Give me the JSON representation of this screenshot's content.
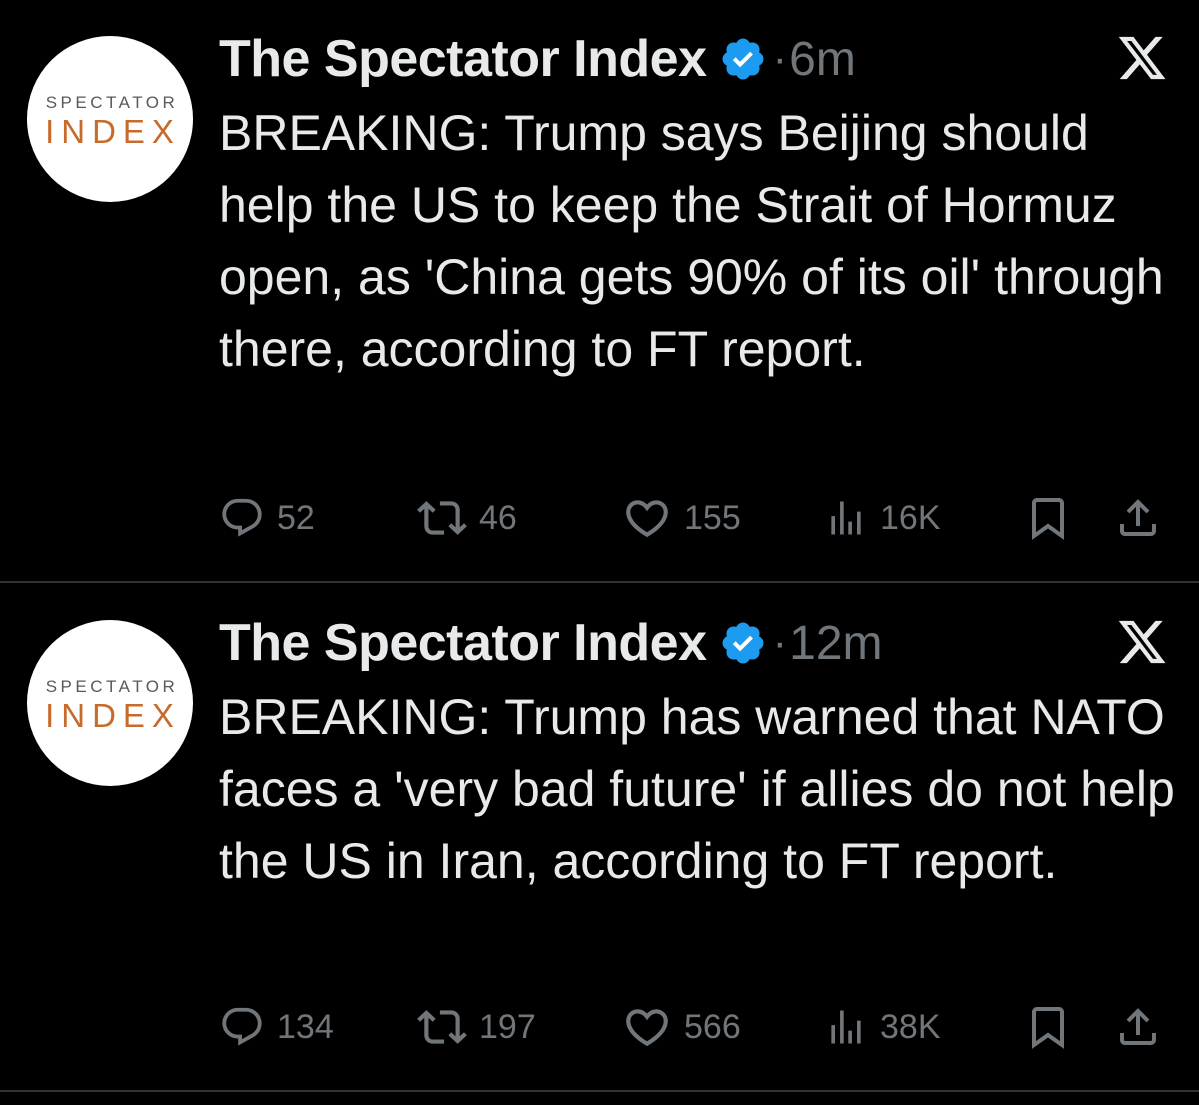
{
  "tweets": [
    {
      "avatar": {
        "line1": "SPECTATOR",
        "line2": "INDEX"
      },
      "author": "The Spectator Index",
      "separator": "·",
      "time": "6m",
      "text": "BREAKING: Trump says Beijing should help the US to keep the Strait of Hormuz open, as 'China gets 90% of its oil' through there, according to FT report.",
      "stats": {
        "replies": "52",
        "reposts": "46",
        "likes": "155",
        "views": "16K"
      }
    },
    {
      "avatar": {
        "line1": "SPECTATOR",
        "line2": "INDEX"
      },
      "author": "The Spectator Index",
      "separator": "·",
      "time": "12m",
      "text": "BREAKING: Trump has warned that NATO faces a 'very bad future' if allies do not help the US in Iran, according to FT report.",
      "stats": {
        "replies": "134",
        "reposts": "197",
        "likes": "566",
        "views": "38K"
      }
    }
  ],
  "colors": {
    "background": "#000000",
    "text": "#e7e9ea",
    "muted": "#71767b",
    "verified": "#1d9bf0",
    "divider": "#2f3336",
    "avatar_orange": "#c86b2a"
  },
  "icons": [
    "verified-badge-icon",
    "x-logo-icon",
    "reply-icon",
    "repost-icon",
    "like-icon",
    "views-icon",
    "bookmark-icon",
    "share-icon"
  ]
}
